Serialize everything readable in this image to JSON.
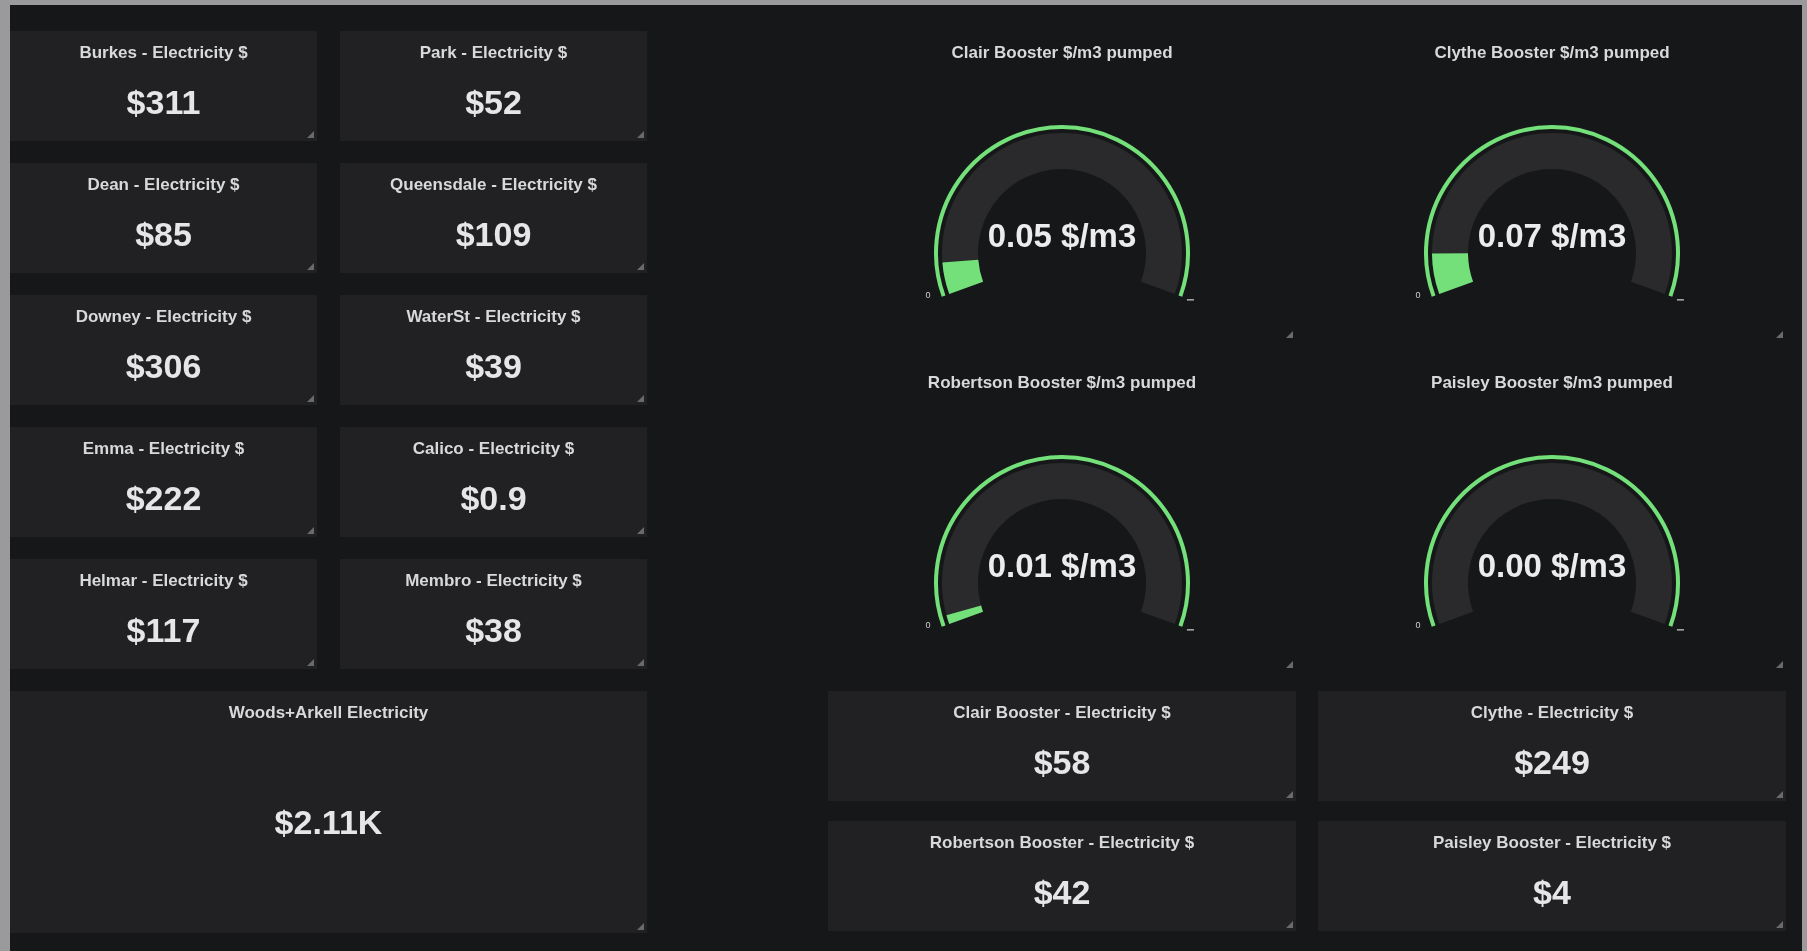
{
  "stat_panels": [
    {
      "title": "Burkes - Electricity $",
      "value": "$311"
    },
    {
      "title": "Park - Electricity $",
      "value": "$52"
    },
    {
      "title": "Dean - Electricity $",
      "value": "$85"
    },
    {
      "title": "Queensdale - Electricity $",
      "value": "$109"
    },
    {
      "title": "Downey - Electricity $",
      "value": "$306"
    },
    {
      "title": "WaterSt - Electricity $",
      "value": "$39"
    },
    {
      "title": "Emma - Electricity $",
      "value": "$222"
    },
    {
      "title": "Calico - Electricity $",
      "value": "$0.9"
    },
    {
      "title": "Helmar - Electricity $",
      "value": "$117"
    },
    {
      "title": "Membro - Electricity $",
      "value": "$38"
    }
  ],
  "total_panel": {
    "title": "Woods+Arkell Electricity",
    "value": "$2.11K"
  },
  "gauges": [
    {
      "title": "Clair Booster $/m3 pumped",
      "value": "0.05 $/m3",
      "min_label": "0",
      "level": 0.07
    },
    {
      "title": "Clythe Booster $/m3 pumped",
      "value": "0.07 $/m3",
      "min_label": "0",
      "level": 0.09
    },
    {
      "title": "Robertson Booster $/m3 pumped",
      "value": "0.01 $/m3",
      "min_label": "0",
      "level": 0.02
    },
    {
      "title": "Paisley Booster $/m3 pumped",
      "value": "0.00 $/m3",
      "min_label": "0",
      "level": 0
    }
  ],
  "booster_stats": [
    {
      "title": "Clair Booster - Electricity $",
      "value": "$58"
    },
    {
      "title": "Clythe - Electricity $",
      "value": "$249"
    },
    {
      "title": "Robertson Booster - Electricity $",
      "value": "$42"
    },
    {
      "title": "Paisley Booster - Electricity $",
      "value": "$4"
    }
  ]
}
